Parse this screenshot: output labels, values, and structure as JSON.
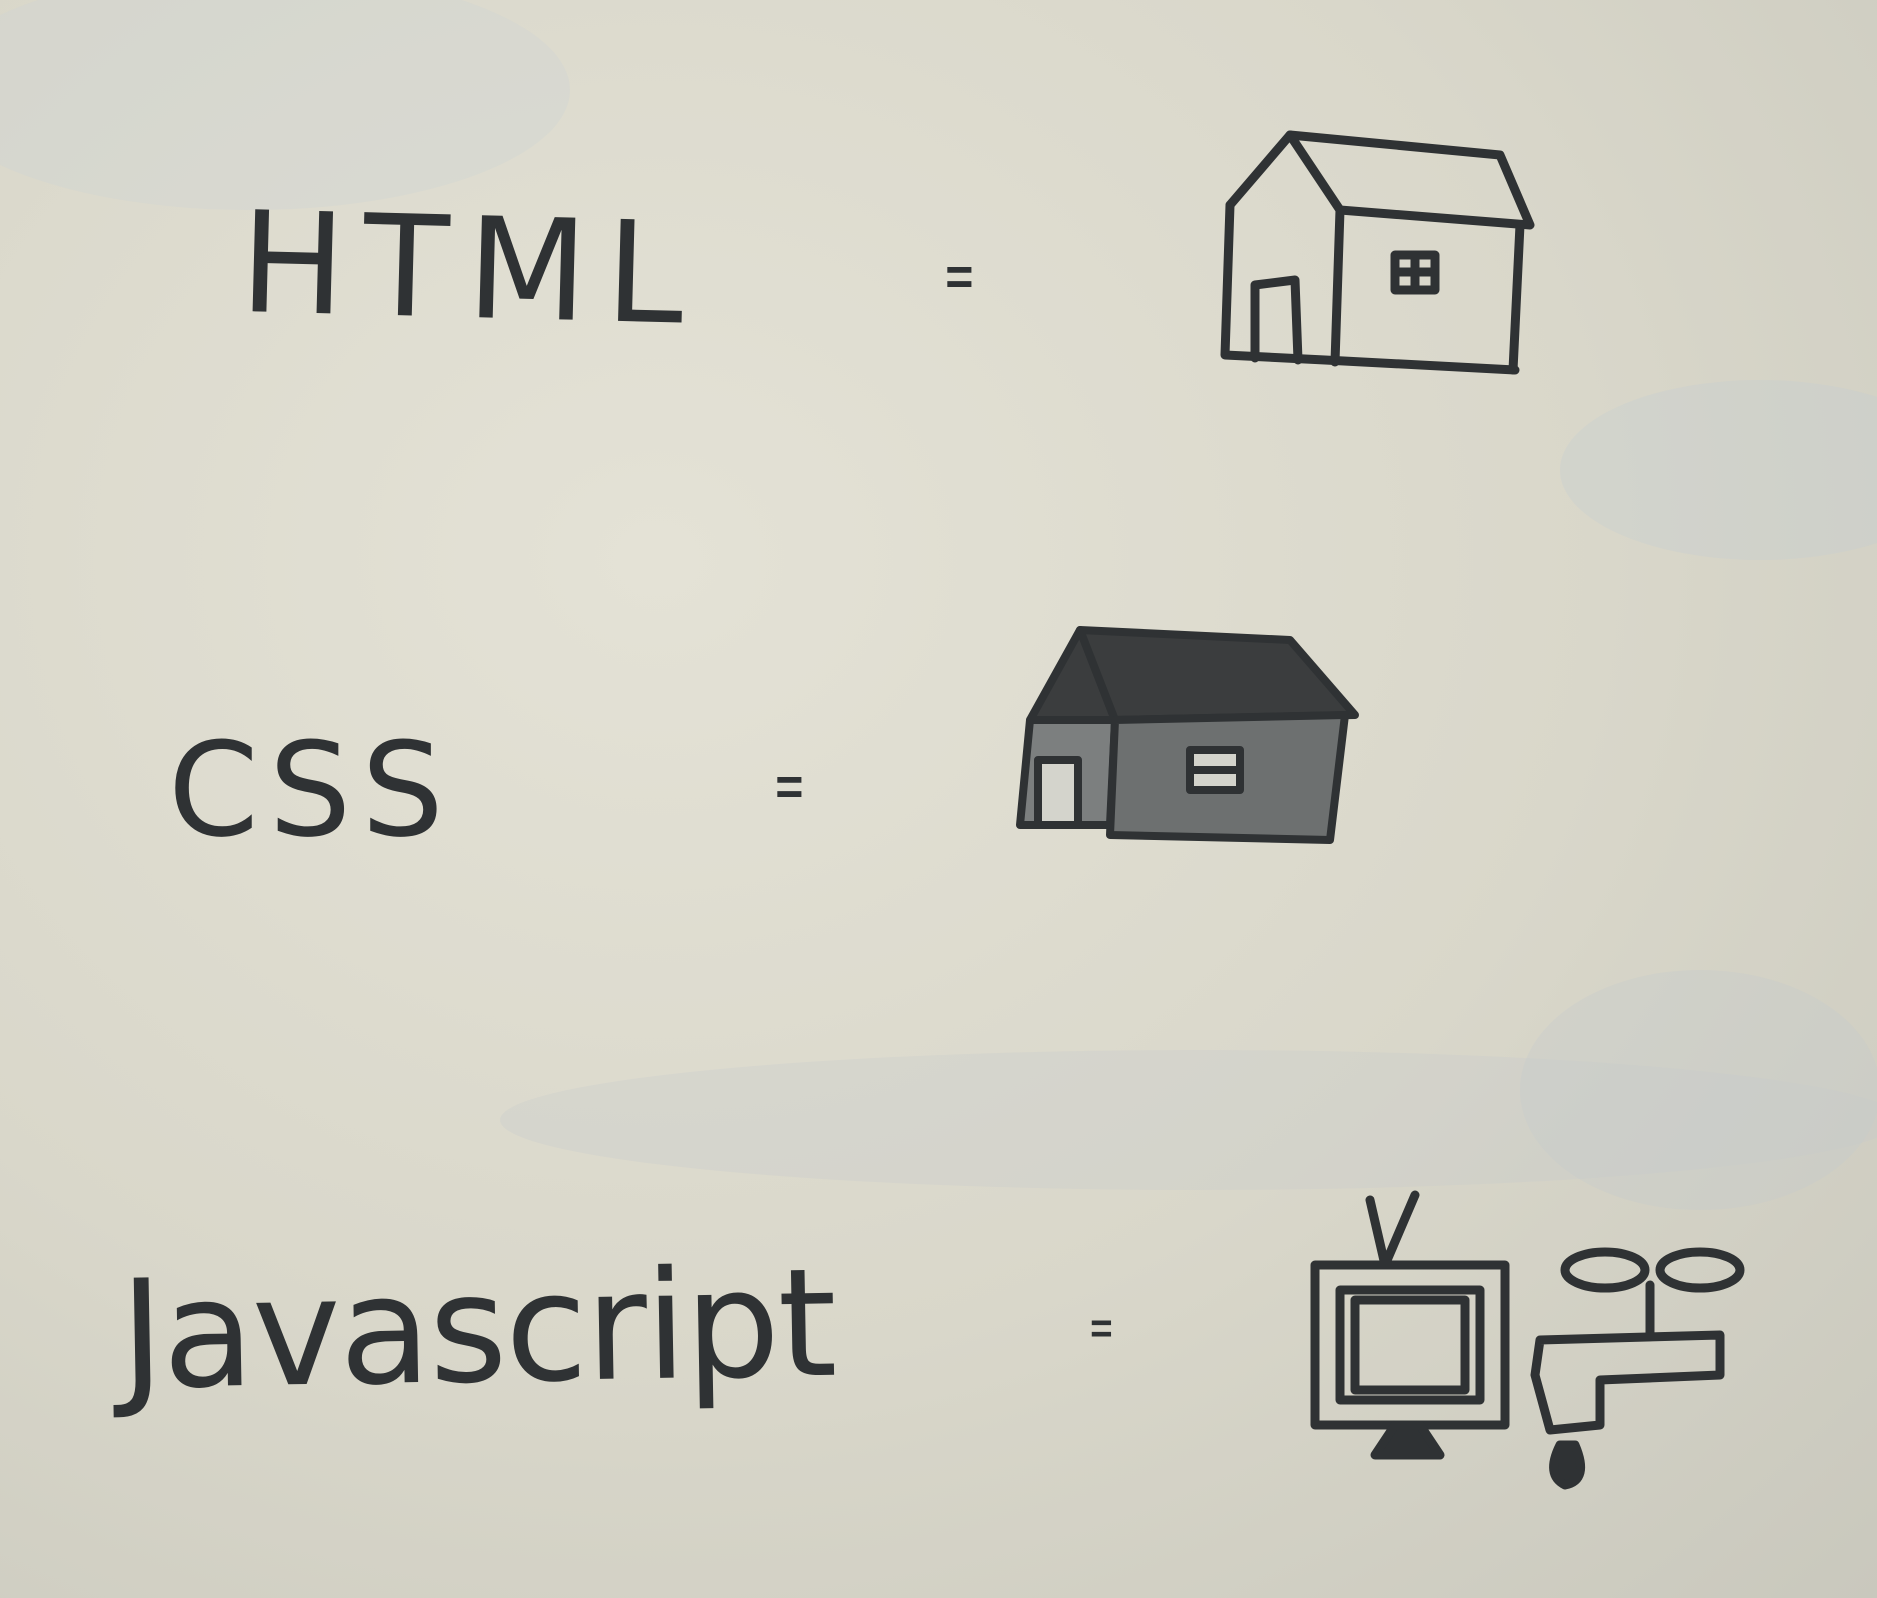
{
  "page": {
    "paper_color": "#dcdacd",
    "ink_color": "#2f3234"
  },
  "rows": [
    {
      "term": "HTML",
      "equals": "=",
      "drawing": "house-outline-icon"
    },
    {
      "term": "CSS",
      "equals": "=",
      "drawing": "house-filled-icon"
    },
    {
      "term": "Javascript",
      "equals": "=",
      "drawing": [
        "television-icon",
        "water-tap-icon"
      ]
    }
  ]
}
